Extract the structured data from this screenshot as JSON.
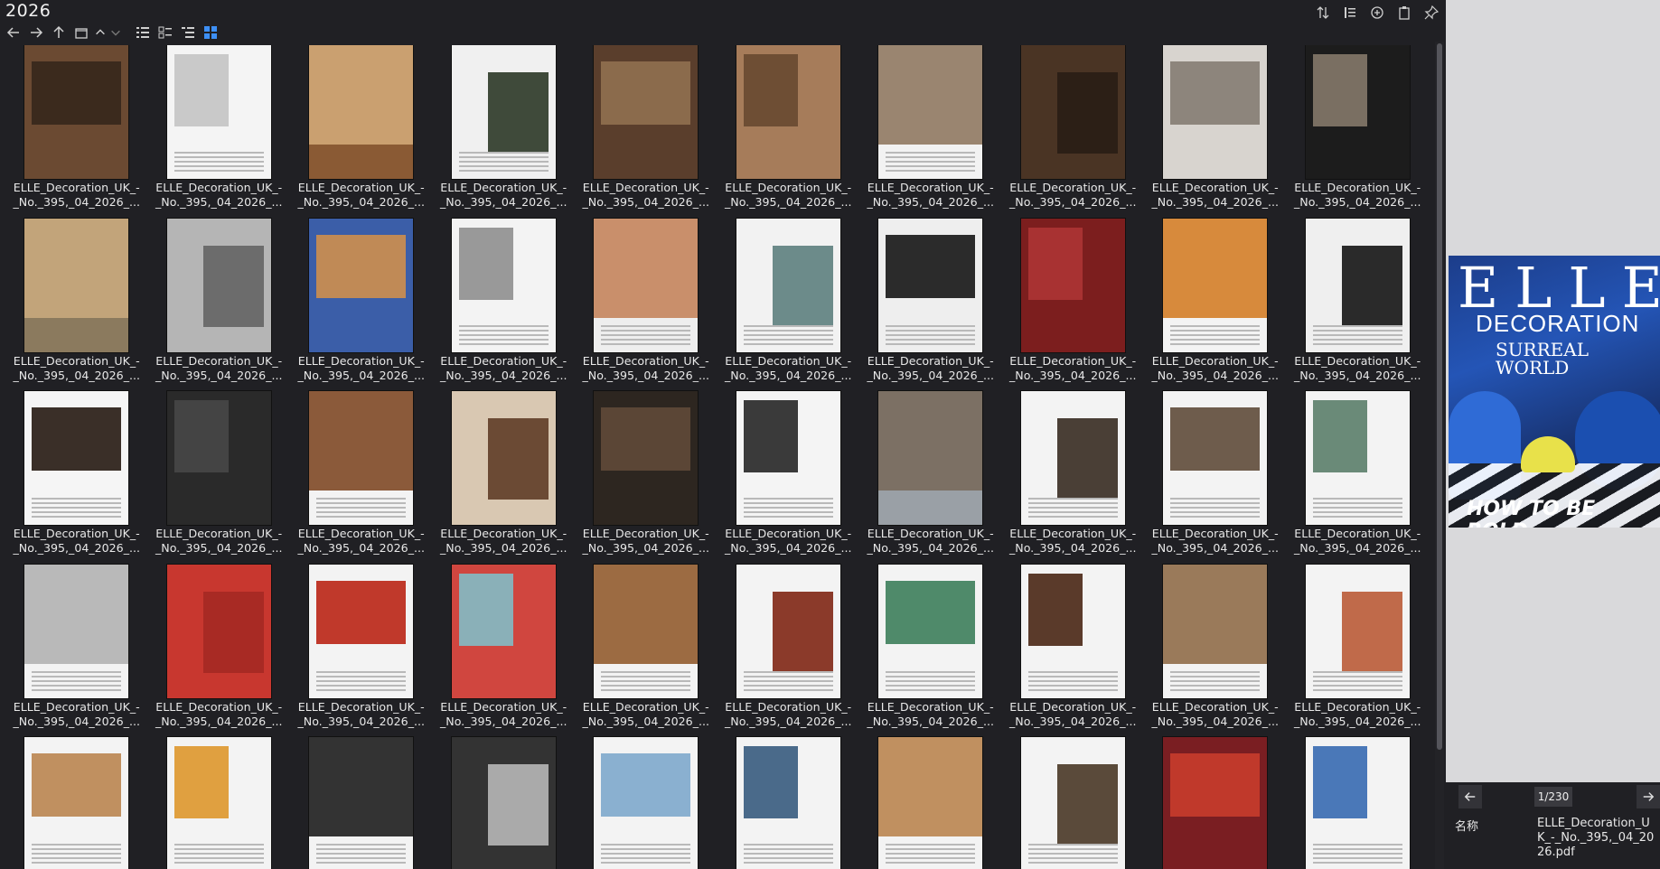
{
  "window": {
    "title": "2026"
  },
  "toolbar": {
    "nav": [
      "back-icon",
      "forward-icon",
      "up-icon",
      "folder-icon",
      "chevron-up-icon",
      "chevron-down-icon"
    ],
    "views": [
      "list-view-icon",
      "detail-view-icon",
      "tree-view-icon",
      "grid-view-icon"
    ],
    "active_view": "grid-view-icon",
    "right_tools": [
      "sort-icon",
      "list-lines-icon",
      "add-circle-icon",
      "clipboard-icon",
      "pin-icon"
    ]
  },
  "grid": {
    "caption_line1": "ELLE_Decoration_UK_-",
    "caption_line2": "_No._395,_04_2026_..."
  },
  "preview": {
    "cover": {
      "masthead": "ELLE",
      "decoration": "DECORATION",
      "headline": "SURREAL WORLD",
      "tagline": "HOW TO BE BOLD"
    },
    "page_indicator": "1/230",
    "meta_label": "名称",
    "meta_value": "ELLE_Decoration_UK_-_No._395,_04_2026.pdf"
  },
  "colors": {
    "background": "#202024",
    "accent": "#3d8ff5",
    "preview_bg": "#d9d9db"
  }
}
